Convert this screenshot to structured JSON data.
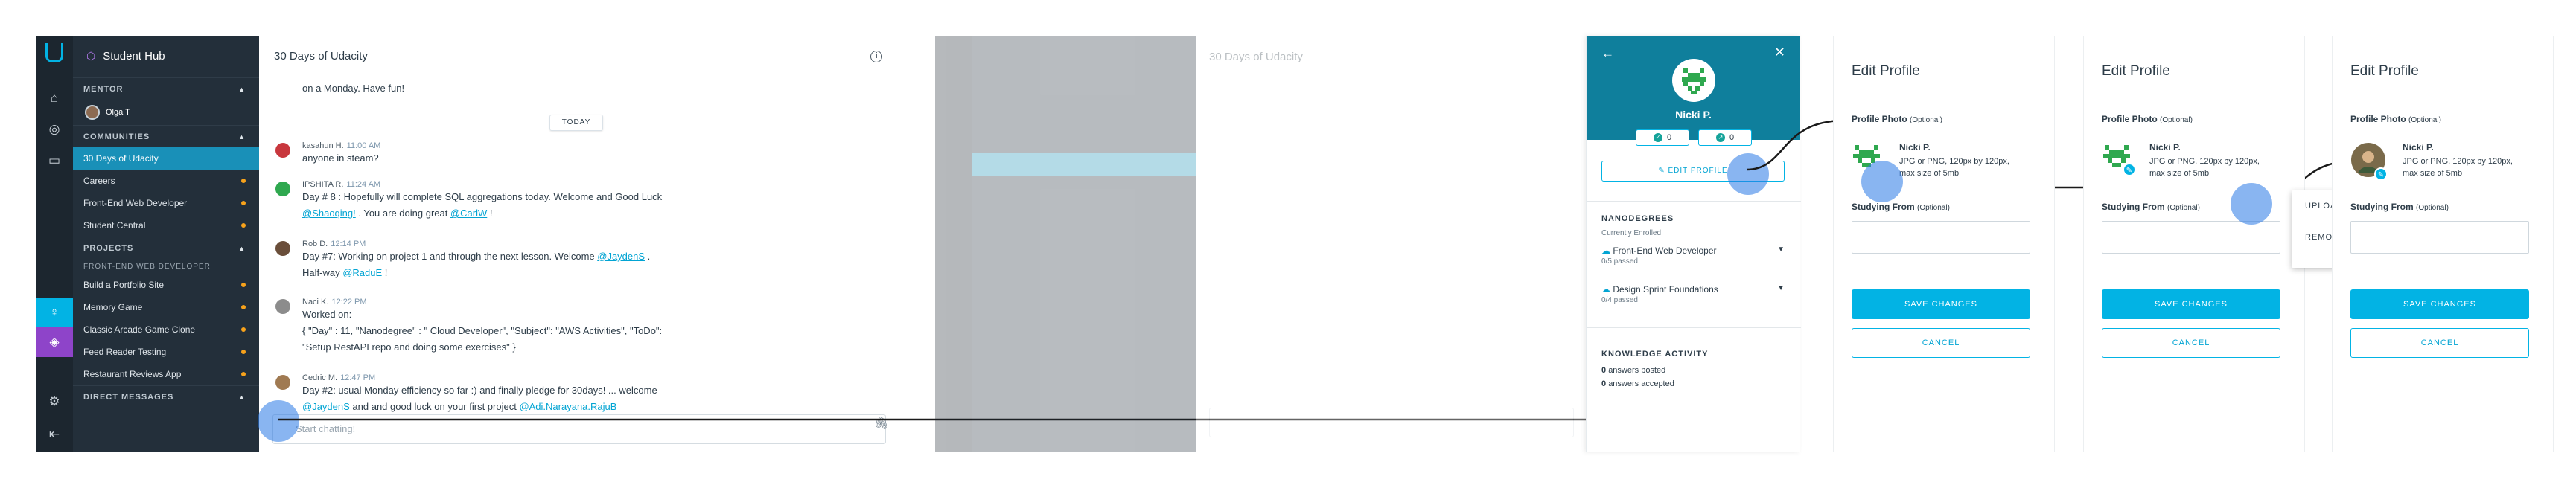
{
  "s1": {
    "app_title": "Student Hub",
    "sections": {
      "mentor": "MENTOR",
      "communities": "COMMUNITIES",
      "projects": "PROJECTS",
      "direct": "DIRECT MESSAGES"
    },
    "mentor_name": "Olga T",
    "communities": [
      "30 Days of Udacity",
      "Careers",
      "Front-End Web Developer",
      "Student Central"
    ],
    "project_group": "FRONT-END WEB DEVELOPER",
    "projects": [
      "Build a Portfolio Site",
      "Memory Game",
      "Classic Arcade Game Clone",
      "Feed Reader Testing",
      "Restaurant Reviews App"
    ],
    "channel_title": "30 Days of Udacity",
    "today": "TODAY",
    "intro_line": "on a Monday. Have fun!",
    "messages": [
      {
        "name": "kasahun H.",
        "time": "11:00 AM",
        "lines": [
          "anyone in steam?"
        ],
        "color": "#c8373d"
      },
      {
        "name": "IPSHITA R.",
        "time": "11:24 AM",
        "lines": [
          "Day # 8 : Hopefully will complete SQL aggregations today. Welcome and Good Luck",
          "@Shaoqing! . You are doing great @CarlW !"
        ],
        "color": "#2fa84f"
      },
      {
        "name": "Rob D.",
        "time": "12:14 PM",
        "lines": [
          "Day #7: Working on project 1 and through the next lesson. Welcome @JaydenS .",
          "Half-way @RaduE !"
        ],
        "color": "#6a4e3a"
      },
      {
        "name": "Naci K.",
        "time": "12:22 PM",
        "lines": [
          "Worked on:",
          "{ \"Day\" : 11, \"Nanodegree\" : \" Cloud Developer\", \"Subject\": \"AWS Activities\", \"ToDo\":",
          "\"Setup RestAPI repo and doing some exercises\" }"
        ],
        "color": "#8c8c8c"
      },
      {
        "name": "Cedric M.",
        "time": "12:47 PM",
        "lines": [
          "Day #2: usual Monday efficiency so far :) and finally pledge for 30days! ... welcome",
          "@JaydenS and and good luck on your first project @Adi.Narayana.RajuB"
        ],
        "color": "#a07a52"
      }
    ],
    "chat_placeholder": "Start chatting!"
  },
  "profile": {
    "name": "Nicki P.",
    "count_a": "0",
    "count_b": "0",
    "edit_label": "EDIT PROFILE",
    "nanodegrees_title": "NANODEGREES",
    "currently": "Currently Enrolled",
    "nd1": "Front-End Web Developer",
    "nd1_sub": "0/5 passed",
    "nd2": "Design Sprint Foundations",
    "nd2_sub": "0/4 passed",
    "knowledge_title": "KNOWLEDGE ACTIVITY",
    "answers_posted_n": "0",
    "answers_posted": "answers posted",
    "answers_accepted_n": "0",
    "answers_accepted": "answers accepted"
  },
  "edit": {
    "title": "Edit Profile",
    "photo_label": "Profile Photo",
    "optional": "(Optional)",
    "name": "Nicki P.",
    "desc": "JPG or PNG, 120px by 120px, max size of 5mb",
    "studying_label": "Studying From",
    "save": "SAVE CHANGES",
    "cancel": "CANCEL",
    "upload": "UPLOAD NEW IMAGE",
    "remove": "REMOVE IMAGE"
  },
  "colors": {
    "accent": "#02b3e4",
    "sidebar": "#232f3a",
    "rail": "#1c262f",
    "header_teal": "#0f7f9c",
    "tap": "#2878e6"
  }
}
